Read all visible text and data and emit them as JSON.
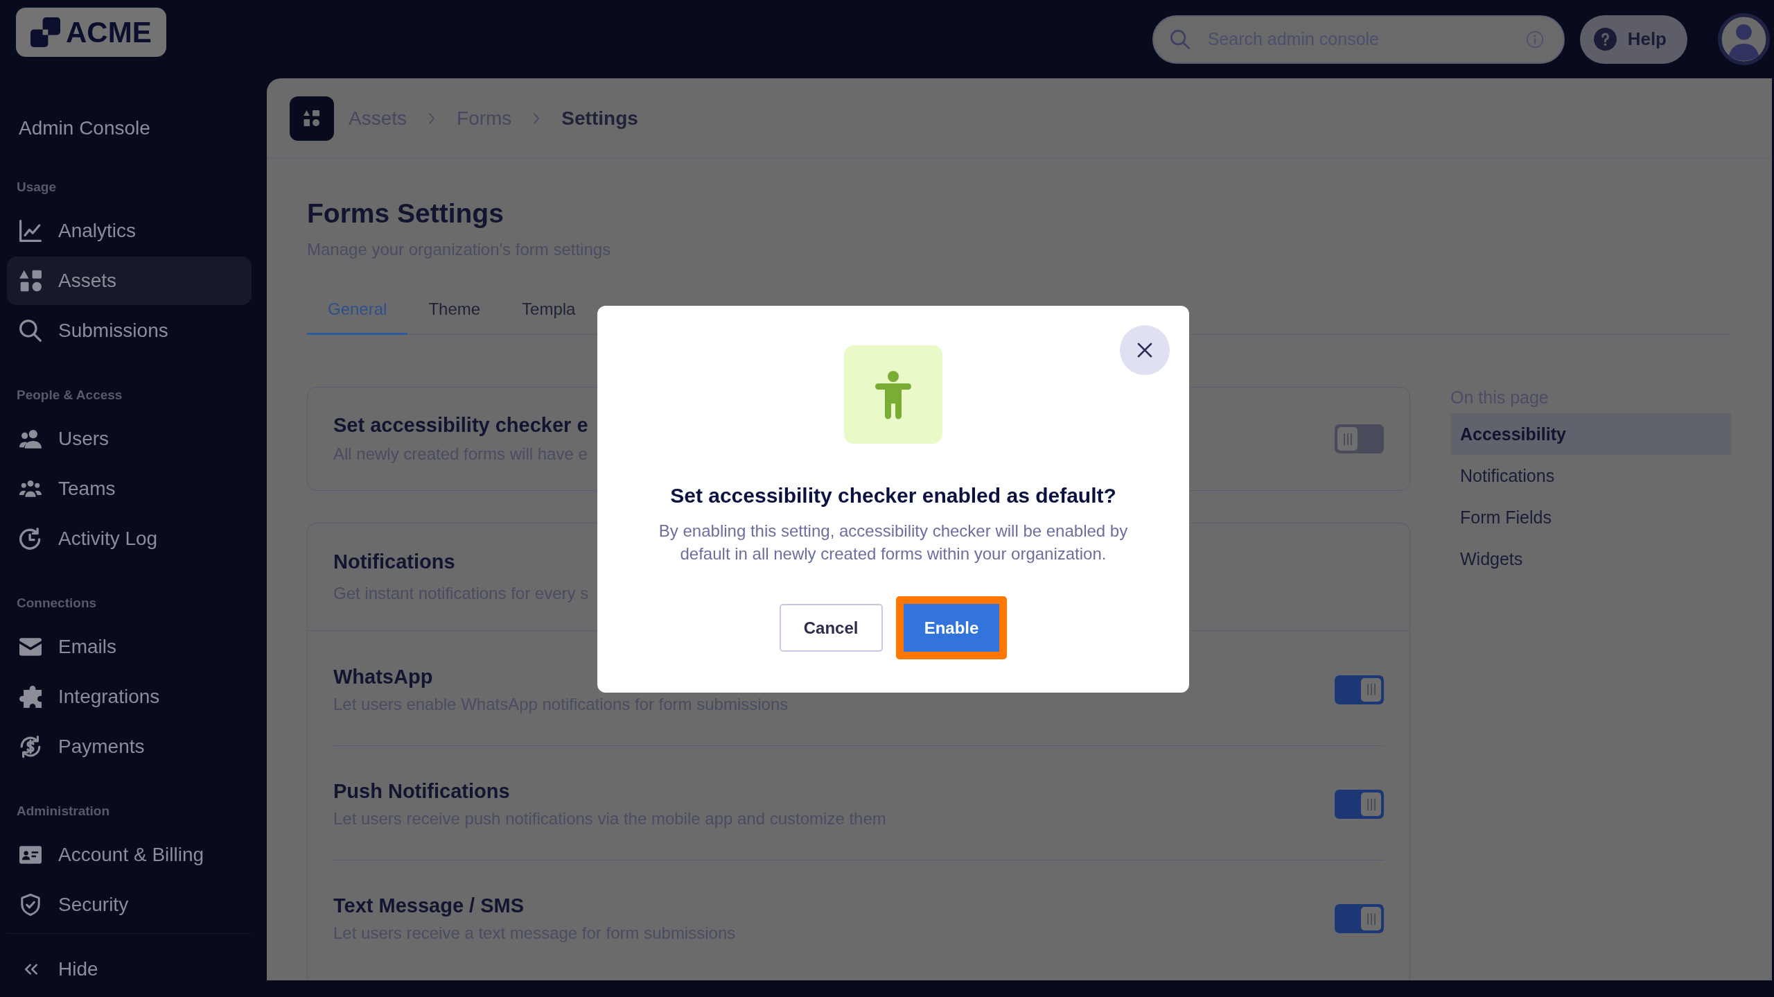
{
  "sidebar": {
    "logo": "ACME",
    "title": "Admin Console",
    "sections": [
      {
        "heading": "Usage",
        "items": [
          {
            "label": "Analytics",
            "selected": false
          },
          {
            "label": "Assets",
            "selected": true
          },
          {
            "label": "Submissions",
            "selected": false
          }
        ]
      },
      {
        "heading": "People & Access",
        "items": [
          {
            "label": "Users",
            "selected": false
          },
          {
            "label": "Teams",
            "selected": false
          },
          {
            "label": "Activity Log",
            "selected": false
          }
        ]
      },
      {
        "heading": "Connections",
        "items": [
          {
            "label": "Emails",
            "selected": false
          },
          {
            "label": "Integrations",
            "selected": false
          },
          {
            "label": "Payments",
            "selected": false
          }
        ]
      },
      {
        "heading": "Administration",
        "items": [
          {
            "label": "Account & Billing",
            "selected": false
          },
          {
            "label": "Security",
            "selected": false
          }
        ]
      }
    ],
    "hide": "Hide"
  },
  "topbar": {
    "search": {
      "placeholder": "Search admin console"
    },
    "help": "Help"
  },
  "breadcrumb": [
    {
      "label": "Assets",
      "current": false
    },
    {
      "label": "Forms",
      "current": false
    },
    {
      "label": "Settings",
      "current": true
    }
  ],
  "page": {
    "title": "Forms Settings",
    "subtitle": "Manage your organization's form settings"
  },
  "tabs": [
    {
      "label": "General",
      "selected": true
    },
    {
      "label": "Theme",
      "selected": false
    },
    {
      "label": "Templa",
      "selected": false
    }
  ],
  "settings": [
    {
      "kind": "single",
      "title": "Set accessibility checker e",
      "description": "All newly created forms will have e",
      "on": false
    },
    {
      "kind": "group",
      "title": "Notifications",
      "description": "Get instant notifications for every s",
      "rows": [
        {
          "title": "WhatsApp",
          "description": "Let users enable WhatsApp notifications for form submissions",
          "on": true
        },
        {
          "title": "Push Notifications",
          "description": "Let users receive push notifications via the mobile app and customize them",
          "on": true
        },
        {
          "title": "Text Message / SMS",
          "description": "Let users receive a text message for form submissions",
          "on": true
        }
      ]
    }
  ],
  "on_this_page": {
    "heading": "On this page",
    "items": [
      {
        "label": "Accessibility",
        "selected": true
      },
      {
        "label": "Notifications",
        "selected": false
      },
      {
        "label": "Form Fields",
        "selected": false
      },
      {
        "label": "Widgets",
        "selected": false
      }
    ]
  },
  "modal": {
    "title": "Set accessibility checker enabled as default?",
    "body": "By enabling this setting, accessibility checker will be enabled by default in all newly created forms within your organization.",
    "buttons": [
      {
        "label": "Cancel",
        "kind": "secondary",
        "highlighted": false
      },
      {
        "label": "Enable",
        "kind": "primary",
        "highlighted": true
      }
    ]
  }
}
